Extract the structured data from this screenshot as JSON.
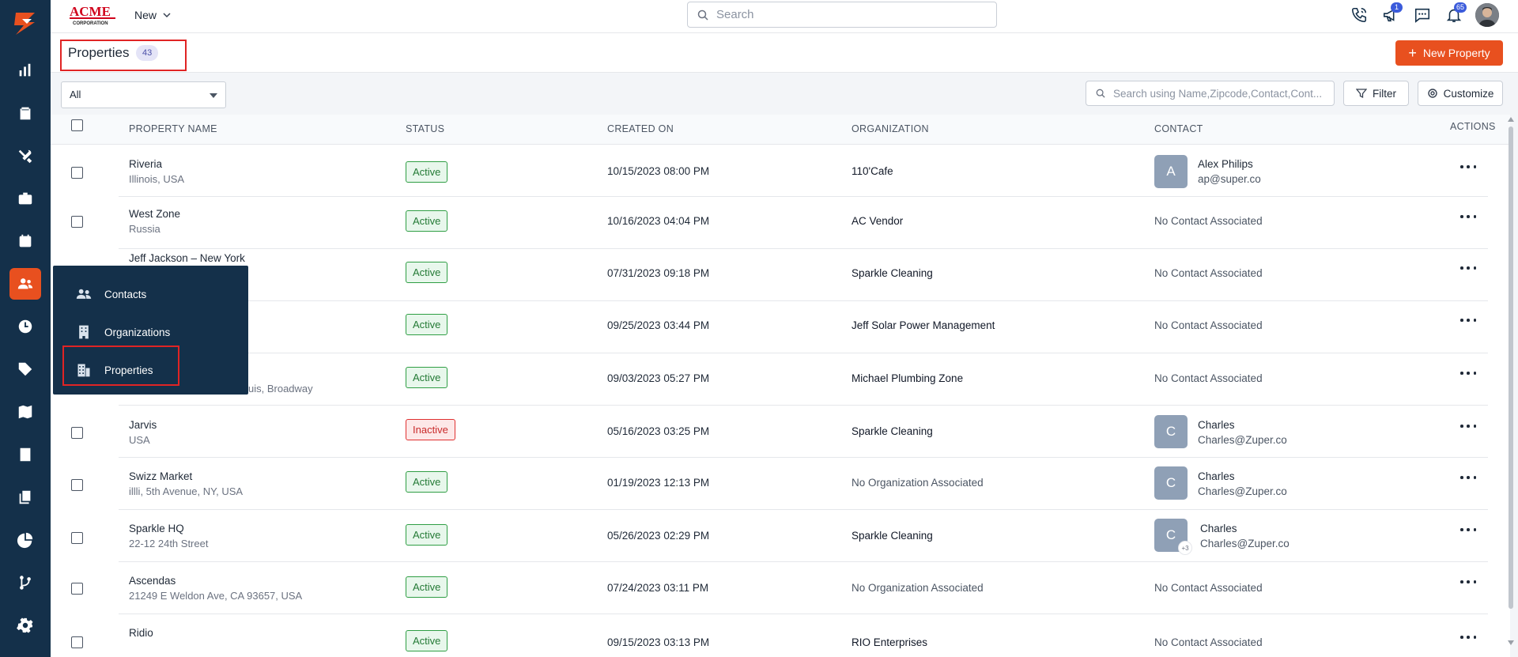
{
  "brand": {
    "name": "ACME",
    "sub": "CORPORATION"
  },
  "header": {
    "new_label": "New",
    "search_placeholder": "Search",
    "notifications": {
      "announcements": "1",
      "alerts": "65"
    }
  },
  "page": {
    "title": "Properties",
    "count": "43",
    "new_button": "New Property"
  },
  "filters": {
    "view_selected": "All",
    "search_placeholder": "Search using Name,Zipcode,Contact,Cont...",
    "filter_label": "Filter",
    "customize_label": "Customize"
  },
  "table": {
    "columns": [
      "PROPERTY NAME",
      "STATUS",
      "CREATED ON",
      "ORGANIZATION",
      "CONTACT",
      "ACTIONS"
    ],
    "rows": [
      {
        "name": "Riveria",
        "address": "Illinois, USA",
        "status": "Active",
        "created": "10/15/2023 08:00 PM",
        "org": "110'Cafe",
        "contact_initial": "A",
        "contact_name": "Alex Philips",
        "contact_email": "ap@super.co"
      },
      {
        "name": "West Zone",
        "address": "Russia",
        "status": "Active",
        "created": "10/16/2023 04:04 PM",
        "org": "AC Vendor",
        "contact": "No Contact Associated"
      },
      {
        "name": "Jeff Jackson – New York",
        "address": "",
        "status": "Active",
        "created": "07/31/2023 09:18 PM",
        "org": "Sparkle Cleaning",
        "contact": "No Contact Associated"
      },
      {
        "name": "",
        "address": "",
        "status": "Active",
        "created": "09/25/2023 03:44 PM",
        "org": "Jeff Solar Power Management",
        "contact": "No Contact Associated"
      },
      {
        "name": "",
        "address": "uis, Broadway",
        "status": "Active",
        "created": "09/03/2023 05:27 PM",
        "org": "Michael Plumbing Zone",
        "contact": "No Contact Associated"
      },
      {
        "name": "Jarvis",
        "address": "USA",
        "status": "Inactive",
        "created": "05/16/2023 03:25 PM",
        "org": "Sparkle Cleaning",
        "contact_initial": "C",
        "contact_name": "Charles",
        "contact_email": "Charles@Zuper.co"
      },
      {
        "name": "Swizz Market",
        "address": "illli, 5th Avenue, NY, USA",
        "status": "Active",
        "created": "01/19/2023 12:13 PM",
        "org": "No Organization Associated",
        "contact_initial": "C",
        "contact_name": "Charles",
        "contact_email": "Charles@Zuper.co"
      },
      {
        "name": "Sparkle HQ",
        "address": "22-12 24th Street",
        "status": "Active",
        "created": "05/26/2023 02:29 PM",
        "org": "Sparkle Cleaning",
        "contact_initial": "C",
        "contact_extra": "+3",
        "contact_name": "Charles",
        "contact_email": "Charles@Zuper.co"
      },
      {
        "name": "Ascendas",
        "address": "21249 E Weldon Ave, CA 93657, USA",
        "status": "Active",
        "created": "07/24/2023 03:11 PM",
        "org": "No Organization Associated",
        "contact": "No Contact Associated"
      },
      {
        "name": "Ridio",
        "address": "",
        "status": "Active",
        "created": "09/15/2023 03:13 PM",
        "org": "RIO Enterprises",
        "contact": "No Contact Associated"
      }
    ]
  },
  "flyout": {
    "items": [
      "Contacts",
      "Organizations",
      "Properties"
    ]
  },
  "colors": {
    "accent": "#e8501f",
    "rail": "#14304a",
    "active_green": "#2f9e44",
    "inactive_red": "#e03131"
  }
}
